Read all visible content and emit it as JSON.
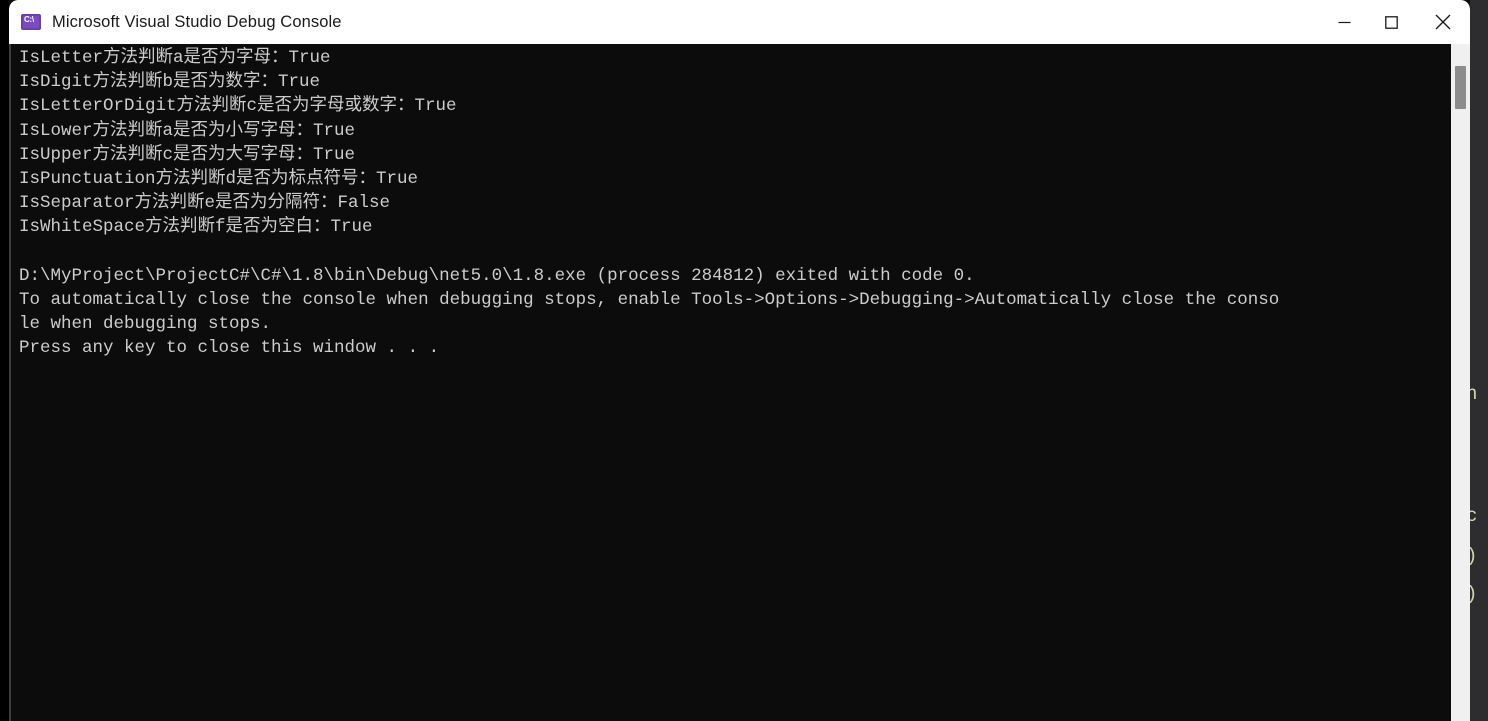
{
  "window": {
    "title": "Microsoft Visual Studio Debug Console",
    "icon": "console-app-icon",
    "controls": {
      "minimize_label": "Minimize",
      "maximize_label": "Maximize",
      "close_label": "Close"
    }
  },
  "console": {
    "background_color": "#0c0c0c",
    "text_color": "#cccccc",
    "lines": [
      "IsLetter方法判断a是否为字母：True",
      "IsDigit方法判断b是否为数字：True",
      "IsLetterOrDigit方法判断c是否为字母或数字：True",
      "IsLower方法判断a是否为小写字母：True",
      "IsUpper方法判断c是否为大写字母：True",
      "IsPunctuation方法判断d是否为标点符号：True",
      "IsSeparator方法判断e是否为分隔符：False",
      "IsWhiteSpace方法判断f是否为空白：True",
      "",
      "D:\\MyProject\\ProjectC#\\C#\\1.8\\bin\\Debug\\net5.0\\1.8.exe (process 284812) exited with code 0.",
      "To automatically close the console when debugging stops, enable Tools->Options->Debugging->Automatically close the conso",
      "le when debugging stops.",
      "Press any key to close this window . . ."
    ]
  },
  "scrollbar": {
    "thumb_position_percent": 3,
    "track_color": "#f0f0f0",
    "thumb_color": "#8c8c8c"
  },
  "backdrop": {
    "description": "Visual Studio editor partially visible at right edge",
    "fragments": [
      "n",
      "c",
      ")",
      ")"
    ]
  }
}
